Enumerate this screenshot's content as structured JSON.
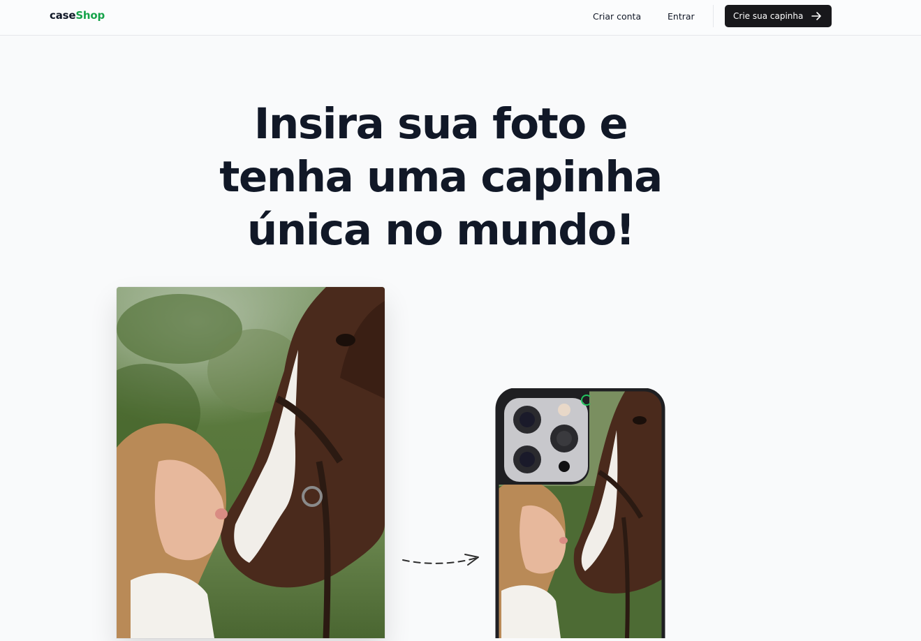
{
  "navbar": {
    "logo_part1": "case",
    "logo_part2": "Shop",
    "signup_label": "Criar conta",
    "login_label": "Entrar",
    "cta_label": "Crie sua capinha"
  },
  "hero": {
    "line1": "Insira sua foto e",
    "line2": "tenha  uma capinha",
    "line3": "única  no mundo!"
  },
  "colors": {
    "brand_green": "#16a34a",
    "dark": "#18181b",
    "text": "#111827",
    "background": "#f9fafb"
  },
  "icons": {
    "cta_icon": "arrow-right-icon",
    "loading_icon": "spinner-icon",
    "flow_arrow": "dashed-arrow-icon"
  }
}
